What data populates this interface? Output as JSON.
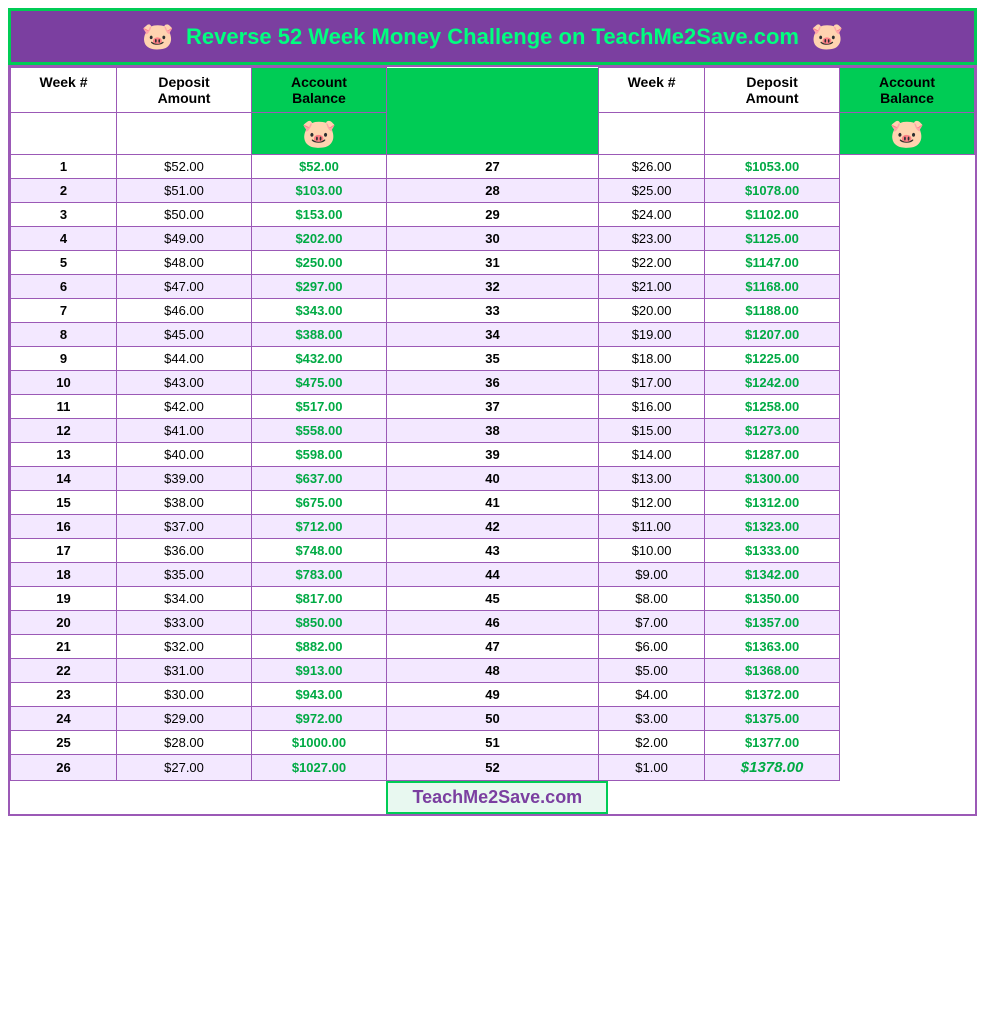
{
  "header": {
    "title": "Reverse 52 Week Money Challenge on TeachMe2Save.com",
    "pig_icon": "🐷"
  },
  "columns": {
    "left": [
      "Week #",
      "Deposit Amount",
      "Account Balance"
    ],
    "right": [
      "Week #",
      "Deposit Amount",
      "Account Balance"
    ]
  },
  "rows_left": [
    {
      "week": 1,
      "deposit": "$52.00",
      "balance": "$52.00"
    },
    {
      "week": 2,
      "deposit": "$51.00",
      "balance": "$103.00"
    },
    {
      "week": 3,
      "deposit": "$50.00",
      "balance": "$153.00"
    },
    {
      "week": 4,
      "deposit": "$49.00",
      "balance": "$202.00"
    },
    {
      "week": 5,
      "deposit": "$48.00",
      "balance": "$250.00"
    },
    {
      "week": 6,
      "deposit": "$47.00",
      "balance": "$297.00"
    },
    {
      "week": 7,
      "deposit": "$46.00",
      "balance": "$343.00"
    },
    {
      "week": 8,
      "deposit": "$45.00",
      "balance": "$388.00"
    },
    {
      "week": 9,
      "deposit": "$44.00",
      "balance": "$432.00"
    },
    {
      "week": 10,
      "deposit": "$43.00",
      "balance": "$475.00"
    },
    {
      "week": 11,
      "deposit": "$42.00",
      "balance": "$517.00"
    },
    {
      "week": 12,
      "deposit": "$41.00",
      "balance": "$558.00"
    },
    {
      "week": 13,
      "deposit": "$40.00",
      "balance": "$598.00"
    },
    {
      "week": 14,
      "deposit": "$39.00",
      "balance": "$637.00"
    },
    {
      "week": 15,
      "deposit": "$38.00",
      "balance": "$675.00"
    },
    {
      "week": 16,
      "deposit": "$37.00",
      "balance": "$712.00"
    },
    {
      "week": 17,
      "deposit": "$36.00",
      "balance": "$748.00"
    },
    {
      "week": 18,
      "deposit": "$35.00",
      "balance": "$783.00"
    },
    {
      "week": 19,
      "deposit": "$34.00",
      "balance": "$817.00"
    },
    {
      "week": 20,
      "deposit": "$33.00",
      "balance": "$850.00"
    },
    {
      "week": 21,
      "deposit": "$32.00",
      "balance": "$882.00"
    },
    {
      "week": 22,
      "deposit": "$31.00",
      "balance": "$913.00"
    },
    {
      "week": 23,
      "deposit": "$30.00",
      "balance": "$943.00"
    },
    {
      "week": 24,
      "deposit": "$29.00",
      "balance": "$972.00"
    },
    {
      "week": 25,
      "deposit": "$28.00",
      "balance": "$1000.00"
    },
    {
      "week": 26,
      "deposit": "$27.00",
      "balance": "$1027.00"
    }
  ],
  "rows_right": [
    {
      "week": 27,
      "deposit": "$26.00",
      "balance": "$1053.00"
    },
    {
      "week": 28,
      "deposit": "$25.00",
      "balance": "$1078.00"
    },
    {
      "week": 29,
      "deposit": "$24.00",
      "balance": "$1102.00"
    },
    {
      "week": 30,
      "deposit": "$23.00",
      "balance": "$1125.00"
    },
    {
      "week": 31,
      "deposit": "$22.00",
      "balance": "$1147.00"
    },
    {
      "week": 32,
      "deposit": "$21.00",
      "balance": "$1168.00"
    },
    {
      "week": 33,
      "deposit": "$20.00",
      "balance": "$1188.00"
    },
    {
      "week": 34,
      "deposit": "$19.00",
      "balance": "$1207.00"
    },
    {
      "week": 35,
      "deposit": "$18.00",
      "balance": "$1225.00"
    },
    {
      "week": 36,
      "deposit": "$17.00",
      "balance": "$1242.00"
    },
    {
      "week": 37,
      "deposit": "$16.00",
      "balance": "$1258.00"
    },
    {
      "week": 38,
      "deposit": "$15.00",
      "balance": "$1273.00"
    },
    {
      "week": 39,
      "deposit": "$14.00",
      "balance": "$1287.00"
    },
    {
      "week": 40,
      "deposit": "$13.00",
      "balance": "$1300.00"
    },
    {
      "week": 41,
      "deposit": "$12.00",
      "balance": "$1312.00"
    },
    {
      "week": 42,
      "deposit": "$11.00",
      "balance": "$1323.00"
    },
    {
      "week": 43,
      "deposit": "$10.00",
      "balance": "$1333.00"
    },
    {
      "week": 44,
      "deposit": "$9.00",
      "balance": "$1342.00"
    },
    {
      "week": 45,
      "deposit": "$8.00",
      "balance": "$1350.00"
    },
    {
      "week": 46,
      "deposit": "$7.00",
      "balance": "$1357.00"
    },
    {
      "week": 47,
      "deposit": "$6.00",
      "balance": "$1363.00"
    },
    {
      "week": 48,
      "deposit": "$5.00",
      "balance": "$1368.00"
    },
    {
      "week": 49,
      "deposit": "$4.00",
      "balance": "$1372.00"
    },
    {
      "week": 50,
      "deposit": "$3.00",
      "balance": "$1375.00"
    },
    {
      "week": 51,
      "deposit": "$2.00",
      "balance": "$1377.00"
    },
    {
      "week": 52,
      "deposit": "$1.00",
      "balance": "$1378.00"
    }
  ],
  "footer": {
    "brand": "TeachMe2Save.com"
  }
}
